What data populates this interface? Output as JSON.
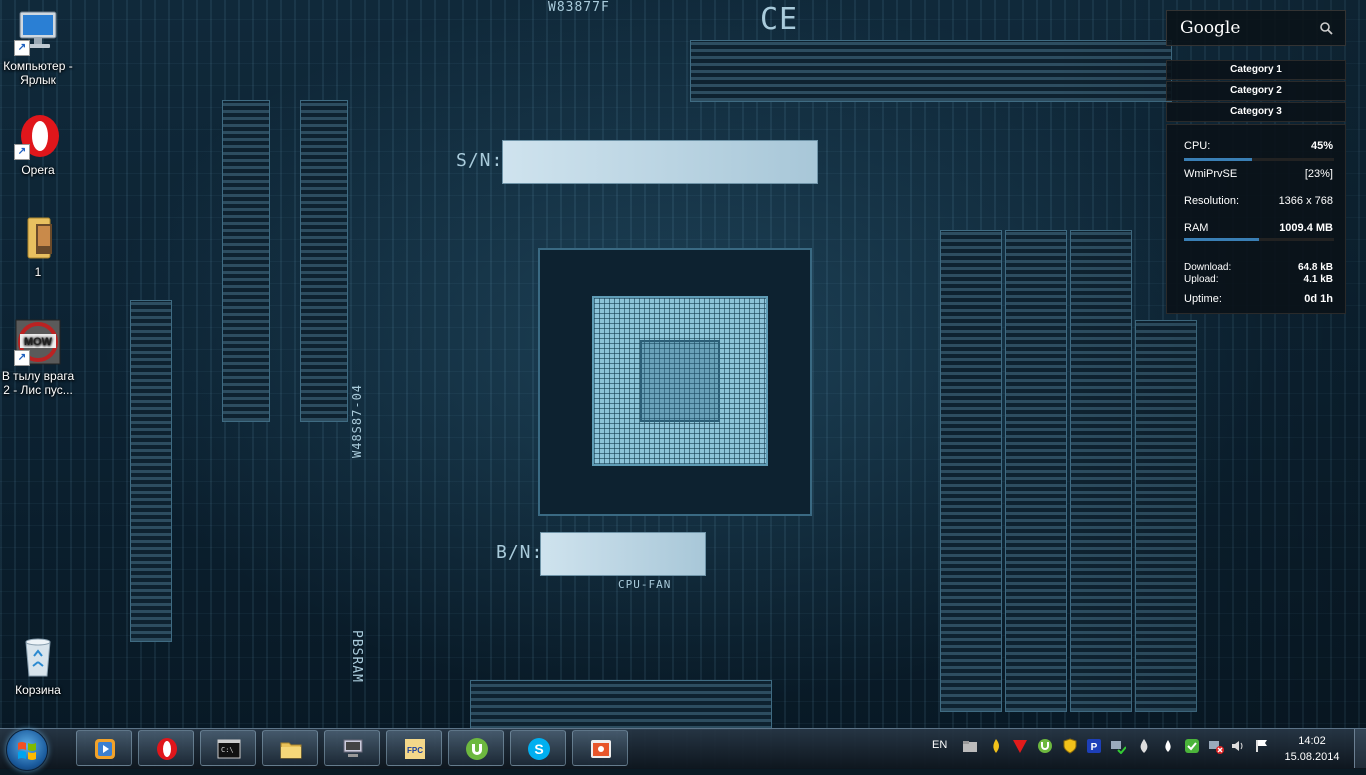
{
  "desktop": {
    "icons": [
      {
        "label": "Компьютер - Ярлык",
        "icon": "computer-icon"
      },
      {
        "label": "Opera",
        "icon": "opera-icon"
      },
      {
        "label": "1",
        "icon": "folder-icon"
      },
      {
        "label": "В тылу врага 2 - Лис пус...",
        "icon": "game-icon"
      },
      {
        "label": "Корзина",
        "icon": "recycle-bin-icon"
      }
    ],
    "wallpaper_text": {
      "sn": "S/N:",
      "bn": "B/N:",
      "ce": "CE",
      "chip": "W83877F",
      "cpu_fan": "CPU-FAN",
      "pbsram": "PBSRAM",
      "w48": "W48S87-04"
    }
  },
  "sidebar": {
    "google": {
      "title": "Google",
      "icon": "search-icon"
    },
    "categories": [
      "Category 1",
      "Category 2",
      "Category 3"
    ],
    "sysmon": {
      "cpu_label": "CPU:",
      "cpu_value": "45%",
      "cpu_fraction": 0.45,
      "process_label": "WmiPrvSE",
      "process_value": "[23%]",
      "resolution_label": "Resolution:",
      "resolution_value": "1366 x 768",
      "ram_label": "RAM",
      "ram_value": "1009.4 MB",
      "ram_fraction": 0.5,
      "download_label": "Download:",
      "download_value": "64.8 kB",
      "upload_label": "Upload:",
      "upload_value": "4.1 kB",
      "uptime_label": "Uptime:",
      "uptime_value": "0d 1h"
    }
  },
  "taskbar": {
    "start_icon": "windows-start-icon",
    "buttons": [
      {
        "name": "media-player",
        "icon": "media-player-icon"
      },
      {
        "name": "opera",
        "icon": "opera-icon"
      },
      {
        "name": "command-prompt",
        "icon": "cmd-icon",
        "text": "C:\\"
      },
      {
        "name": "explorer",
        "icon": "folder-icon"
      },
      {
        "name": "device-manager",
        "icon": "computer-icon"
      },
      {
        "name": "fpc",
        "icon": "fpc-icon",
        "text": "FPC"
      },
      {
        "name": "utorrent",
        "icon": "utorrent-icon"
      },
      {
        "name": "skype",
        "icon": "skype-icon"
      },
      {
        "name": "app",
        "icon": "orange-app-icon"
      }
    ],
    "language": "EN",
    "tray_icons": [
      "folder-tray-icon",
      "flame-tray-icon",
      "antivirus-tray-icon",
      "utorrent-tray-icon",
      "shield-tray-icon",
      "p-tray-icon",
      "network-ok-tray-icon",
      "drop-tray-icon",
      "green-app-tray-icon",
      "network-error-tray-icon",
      "volume-icon",
      "action-center-icon"
    ],
    "time": "14:02",
    "date": "15.08.2014"
  }
}
